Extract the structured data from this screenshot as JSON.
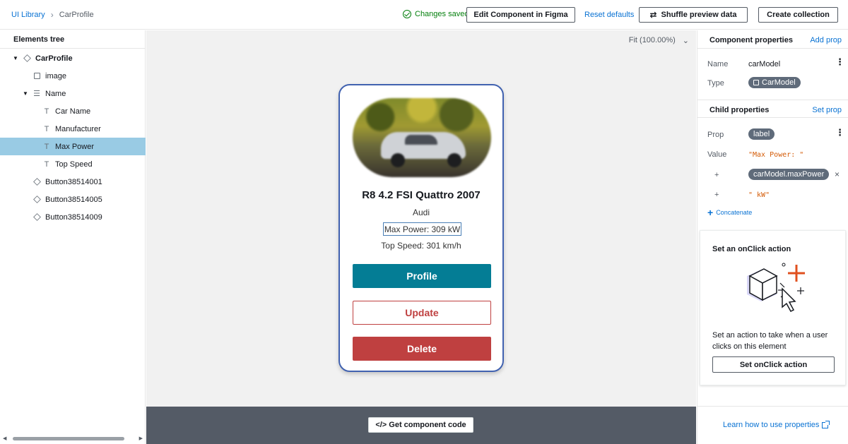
{
  "breadcrumb": {
    "root": "UI Library",
    "current": "CarProfile"
  },
  "status": {
    "saved": "Changes saved"
  },
  "toolbar": {
    "edit_figma": "Edit Component in Figma",
    "reset_defaults": "Reset defaults",
    "shuffle": "Shuffle preview data",
    "create_collection": "Create collection"
  },
  "tree": {
    "title": "Elements tree",
    "items": [
      {
        "label": "CarProfile",
        "icon": "cube-icon",
        "caret": "expanded",
        "level": 0,
        "bold": true
      },
      {
        "label": "image",
        "icon": "image-icon",
        "caret": "",
        "level": 1
      },
      {
        "label": "Name",
        "icon": "stack-icon",
        "caret": "expanded",
        "level": 1
      },
      {
        "label": "Car Name",
        "icon": "text-icon",
        "caret": "",
        "level": 2
      },
      {
        "label": "Manufacturer",
        "icon": "text-icon",
        "caret": "",
        "level": 2
      },
      {
        "label": "Max Power",
        "icon": "text-icon",
        "caret": "",
        "level": 2,
        "selected": true
      },
      {
        "label": "Top Speed",
        "icon": "text-icon",
        "caret": "",
        "level": 2
      },
      {
        "label": "Button38514001",
        "icon": "cube-icon",
        "caret": "",
        "level": 1
      },
      {
        "label": "Button38514005",
        "icon": "cube-icon",
        "caret": "",
        "level": 1
      },
      {
        "label": "Button38514009",
        "icon": "cube-icon",
        "caret": "",
        "level": 1
      }
    ]
  },
  "canvas": {
    "zoom": "Fit (100.00%)",
    "card": {
      "title": "R8 4.2 FSI Quattro 2007",
      "manufacturer": "Audi",
      "max_power": "Max Power: 309 kW",
      "top_speed": "Top Speed: 301 km/h",
      "buttons": {
        "profile": "Profile",
        "update": "Update",
        "delete": "Delete"
      }
    },
    "get_code": "</> Get component code"
  },
  "component_properties": {
    "title": "Component properties",
    "add_link": "Add prop",
    "name_label": "Name",
    "name_value": "carModel",
    "type_label": "Type",
    "type_value": "CarModel"
  },
  "child_properties": {
    "title": "Child properties",
    "set_link": "Set prop",
    "prop_label": "Prop",
    "prop_value": "label",
    "value_label": "Value",
    "value_1": "\"Max Power: \"",
    "plus": "+",
    "value_2": "carModel.maxPower",
    "value_3": "\" kW\"",
    "concatenate": "Concatenate"
  },
  "onclick": {
    "title": "Set an onClick action",
    "description": "Set an action to take when a user clicks on this element",
    "button": "Set onClick action"
  },
  "learn_link": "Learn how to use properties",
  "colors": {
    "accent": "#0972d3",
    "selected_row": "#99cbe4",
    "card_border": "#4162b0",
    "profile_button": "#047d95",
    "danger": "#bf4040",
    "saved_green": "#037f0c",
    "code_orange": "#d45b07"
  }
}
